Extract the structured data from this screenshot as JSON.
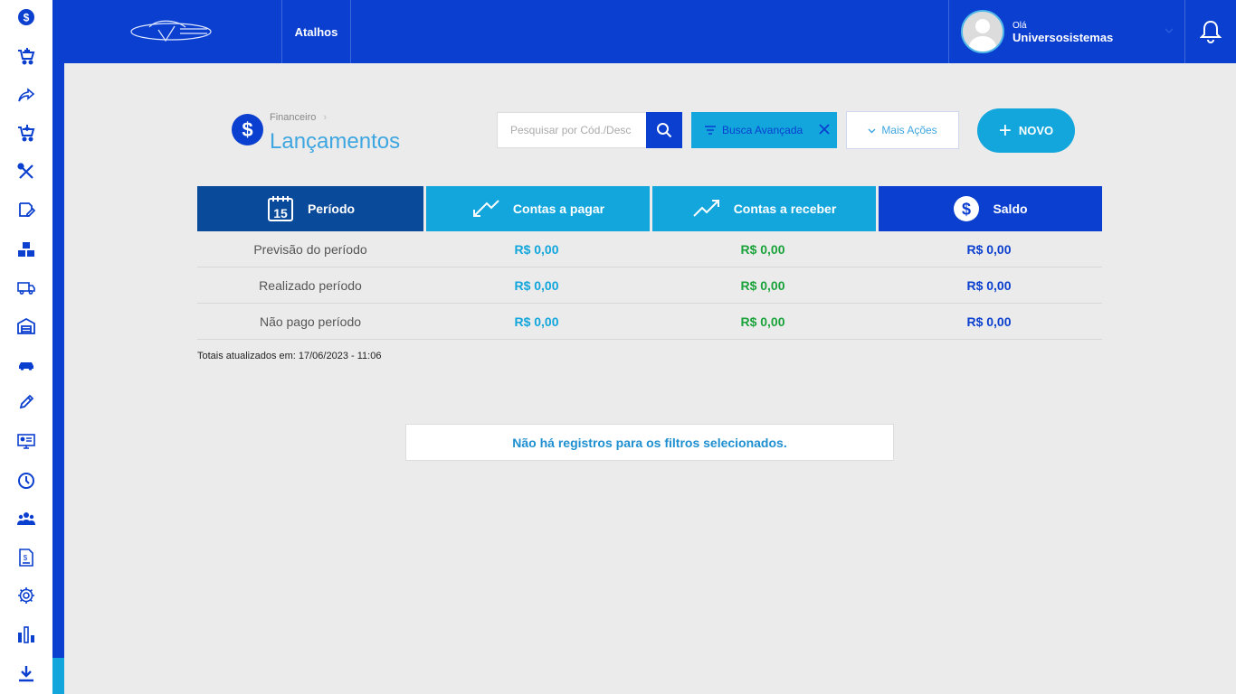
{
  "sidebar": {
    "icons": [
      "dollar-icon",
      "cart-add-icon",
      "share-icon",
      "cart-download-icon",
      "tools-icon",
      "edit-icon",
      "boxes-icon",
      "truck-icon",
      "warehouse-icon",
      "car-icon",
      "pen-icon",
      "monitor-id-icon",
      "clock-icon",
      "users-icon",
      "invoice-icon",
      "gear-icon",
      "bar-chart-icon",
      "download-icon"
    ]
  },
  "topbar": {
    "shortcut_label": "Atalhos",
    "greeting": "Olá",
    "username": "Universosistemas"
  },
  "header": {
    "breadcrumb": "Financeiro",
    "title": "Lançamentos",
    "search_placeholder": "Pesquisar por Cód./Desc",
    "advanced_search_label": "Busca Avançada",
    "more_actions_label": "Mais Ações",
    "new_label": "NOVO"
  },
  "summary": {
    "columns": [
      {
        "label": "Período",
        "color": "#0a4a9a",
        "icon": "calendar-icon"
      },
      {
        "label": "Contas a pagar",
        "color": "#12a6dc",
        "icon": "trend-down-icon"
      },
      {
        "label": "Contas a receber",
        "color": "#12a6dc",
        "icon": "trend-up-icon"
      },
      {
        "label": "Saldo",
        "color": "#0b3fcf",
        "icon": "dollar-circle-icon"
      }
    ],
    "rows": [
      {
        "label": "Previsão do período",
        "pay": "R$ 0,00",
        "receive": "R$ 0,00",
        "balance": "R$ 0,00"
      },
      {
        "label": "Realizado período",
        "pay": "R$ 0,00",
        "receive": "R$ 0,00",
        "balance": "R$ 0,00"
      },
      {
        "label": "Não pago período",
        "pay": "R$ 0,00",
        "receive": "R$ 0,00",
        "balance": "R$ 0,00"
      }
    ],
    "updated_text": "Totais atualizados em: 17/06/2023 - 11:06"
  },
  "empty_message": "Não há registros para os filtros selecionados.",
  "colors": {
    "primary": "#0b3fcf",
    "accent": "#12a6dc",
    "positive": "#1aa33a"
  }
}
